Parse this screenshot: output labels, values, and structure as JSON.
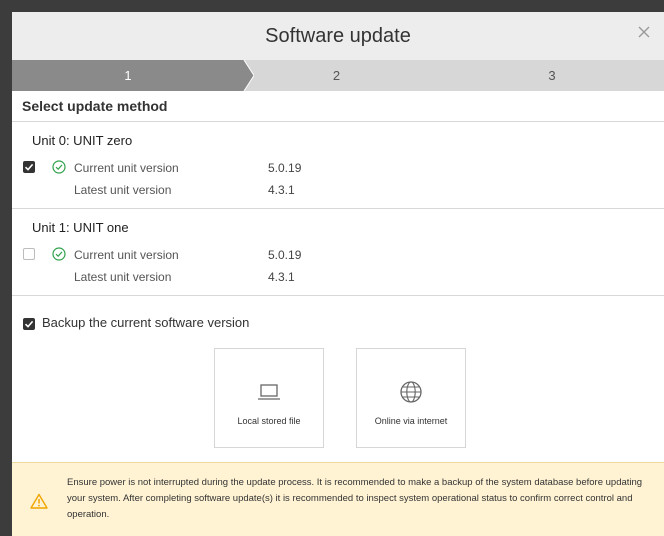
{
  "dialog": {
    "title": "Software update",
    "close_icon": "close-icon"
  },
  "stepper": {
    "steps": [
      {
        "label": "1",
        "active": true
      },
      {
        "label": "2",
        "active": false
      },
      {
        "label": "3",
        "active": false
      }
    ],
    "active_color": "#8a8a8a"
  },
  "section": {
    "title": "Select update method"
  },
  "units": [
    {
      "name": "Unit 0: UNIT zero",
      "selected": true,
      "status_icon": "check-circle-icon",
      "current_label": "Current unit version",
      "current_value": "5.0.19",
      "latest_label": "Latest unit version",
      "latest_value": "4.3.1"
    },
    {
      "name": "Unit 1: UNIT one",
      "selected": false,
      "status_icon": "check-circle-icon",
      "current_label": "Current unit version",
      "current_value": "5.0.19",
      "latest_label": "Latest unit version",
      "latest_value": "4.3.1"
    }
  ],
  "backup": {
    "checked": true,
    "label": "Backup the current software version"
  },
  "methods": [
    {
      "label": "Local stored file",
      "icon": "laptop-icon"
    },
    {
      "label": "Online via internet",
      "icon": "globe-icon"
    }
  ],
  "warning": {
    "icon": "warning-icon",
    "text": "Ensure power is not interrupted during the update process. It is recommended to make a backup of the system database before updating your system. After completing software update(s) it is recommended to inspect system operational status to confirm correct control and operation.",
    "background": "#fff3d4",
    "accent": "#f0a500"
  },
  "colors": {
    "check_green": "#2ea04a",
    "checkbox_dark": "#333333"
  }
}
